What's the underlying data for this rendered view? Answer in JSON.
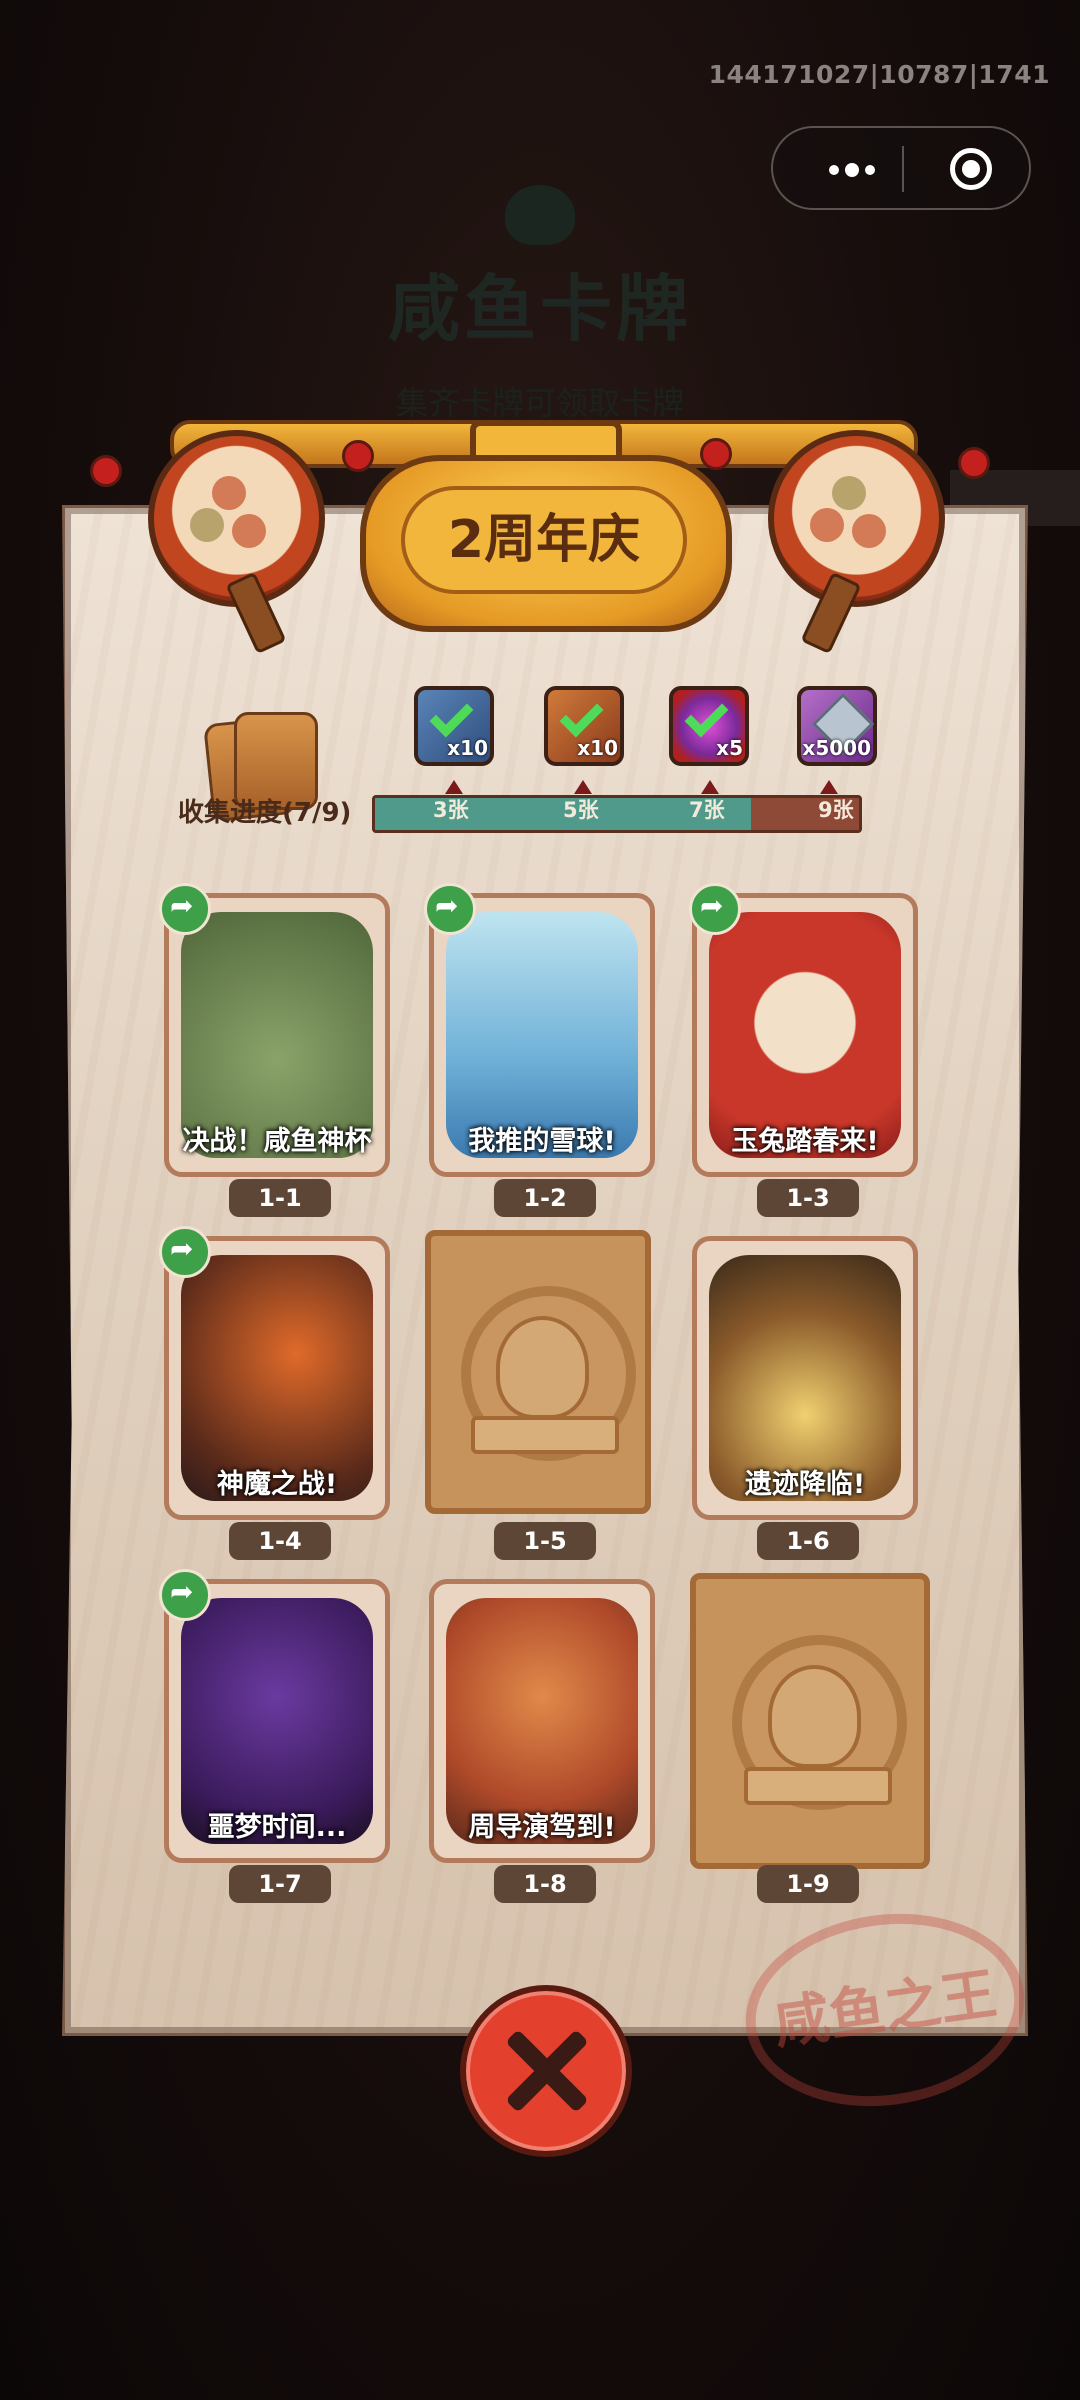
{
  "top_bar": {
    "id_text": "144171027|10787|1741"
  },
  "background": {
    "title": "咸鱼卡牌",
    "subtitle": "集齐卡牌可领取卡牌"
  },
  "banner": {
    "title": "2周年庆"
  },
  "progress": {
    "label": "收集进度(7/9)",
    "collected": 7,
    "total": 9,
    "milestones": [
      {
        "label": "3张",
        "reward": "x10",
        "claimed": true
      },
      {
        "label": "5张",
        "reward": "x10",
        "claimed": true
      },
      {
        "label": "7张",
        "reward": "x5",
        "claimed": true
      },
      {
        "label": "9张",
        "reward": "x5000",
        "claimed": false
      }
    ]
  },
  "cards": [
    {
      "code": "1-1",
      "caption": "决战！咸鱼神杯",
      "unlocked": true,
      "shareable": true
    },
    {
      "code": "1-2",
      "caption": "我推的雪球!",
      "unlocked": true,
      "shareable": true
    },
    {
      "code": "1-3",
      "caption": "玉兔踏春来!",
      "unlocked": true,
      "shareable": true
    },
    {
      "code": "1-4",
      "caption": "神魔之战!",
      "unlocked": true,
      "shareable": true
    },
    {
      "code": "1-5",
      "caption": "",
      "unlocked": false,
      "shareable": false
    },
    {
      "code": "1-6",
      "caption": "遗迹降临!",
      "unlocked": true,
      "shareable": false
    },
    {
      "code": "1-7",
      "caption": "噩梦时间...",
      "unlocked": true,
      "shareable": true
    },
    {
      "code": "1-8",
      "caption": "周导演驾到!",
      "unlocked": true,
      "shareable": false
    },
    {
      "code": "1-9",
      "caption": "",
      "unlocked": false,
      "shareable": false
    }
  ],
  "stamp": {
    "text": "咸鱼之王"
  },
  "icons": {
    "menu": "more-dots-icon",
    "exit": "target-circle-icon",
    "close": "close-x-icon",
    "share": "share-arrow-icon"
  }
}
